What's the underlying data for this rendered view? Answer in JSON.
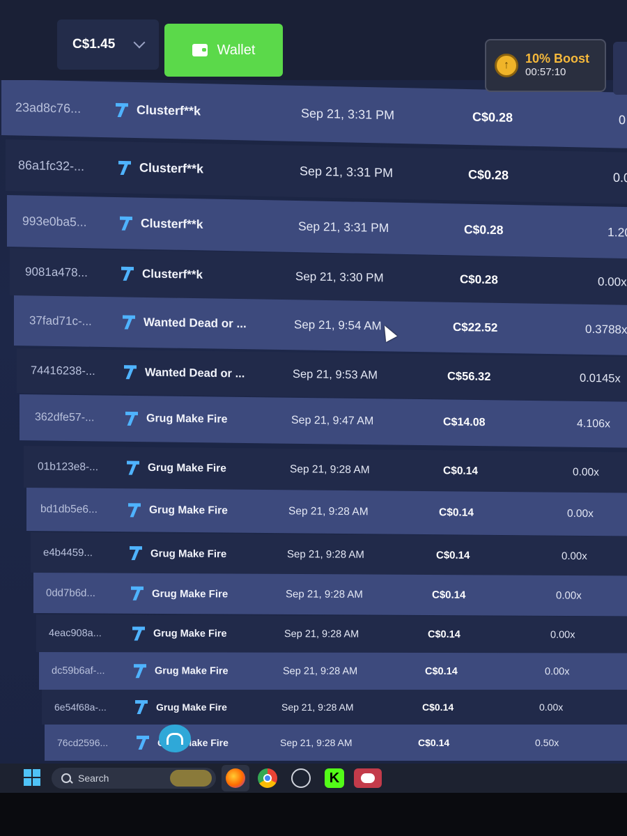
{
  "header": {
    "balance": "C$1.45",
    "wallet_label": "Wallet",
    "boost_label": "10% Boost",
    "boost_timer": "00:57:10"
  },
  "bets": [
    {
      "id": "23ad8c76...",
      "game": "Clusterf**k",
      "date": "Sep 21, 3:31 PM",
      "amount": "C$0.28",
      "multiplier": "0"
    },
    {
      "id": "86a1fc32-...",
      "game": "Clusterf**k",
      "date": "Sep 21, 3:31 PM",
      "amount": "C$0.28",
      "multiplier": "0.0"
    },
    {
      "id": "993e0ba5...",
      "game": "Clusterf**k",
      "date": "Sep 21, 3:31 PM",
      "amount": "C$0.28",
      "multiplier": "1.20"
    },
    {
      "id": "9081a478...",
      "game": "Clusterf**k",
      "date": "Sep 21, 3:30 PM",
      "amount": "C$0.28",
      "multiplier": "0.00x"
    },
    {
      "id": "37fad71c-...",
      "game": "Wanted Dead or ...",
      "date": "Sep 21, 9:54 AM",
      "amount": "C$22.52",
      "multiplier": "0.3788x"
    },
    {
      "id": "74416238-...",
      "game": "Wanted Dead or ...",
      "date": "Sep 21, 9:53 AM",
      "amount": "C$56.32",
      "multiplier": "0.0145x"
    },
    {
      "id": "362dfe57-...",
      "game": "Grug Make Fire",
      "date": "Sep 21, 9:47 AM",
      "amount": "C$14.08",
      "multiplier": "4.106x"
    },
    {
      "id": "01b123e8-...",
      "game": "Grug Make Fire",
      "date": "Sep 21, 9:28 AM",
      "amount": "C$0.14",
      "multiplier": "0.00x"
    },
    {
      "id": "bd1db5e6...",
      "game": "Grug Make Fire",
      "date": "Sep 21, 9:28 AM",
      "amount": "C$0.14",
      "multiplier": "0.00x"
    },
    {
      "id": "e4b4459...",
      "game": "Grug Make Fire",
      "date": "Sep 21, 9:28 AM",
      "amount": "C$0.14",
      "multiplier": "0.00x"
    },
    {
      "id": "0dd7b6d...",
      "game": "Grug Make Fire",
      "date": "Sep 21, 9:28 AM",
      "amount": "C$0.14",
      "multiplier": "0.00x"
    },
    {
      "id": "4eac908a...",
      "game": "Grug Make Fire",
      "date": "Sep 21, 9:28 AM",
      "amount": "C$0.14",
      "multiplier": "0.00x"
    },
    {
      "id": "dc59b6af-...",
      "game": "Grug Make Fire",
      "date": "Sep 21, 9:28 AM",
      "amount": "C$0.14",
      "multiplier": "0.00x"
    },
    {
      "id": "6e54f68a-...",
      "game": "Grug Make Fire",
      "date": "Sep 21, 9:28 AM",
      "amount": "C$0.14",
      "multiplier": "0.00x"
    },
    {
      "id": "76cd2596...",
      "game": "Grug Make Fire",
      "date": "Sep 21, 9:28 AM",
      "amount": "C$0.14",
      "multiplier": "0.50x"
    }
  ],
  "taskbar": {
    "search_label": "Search",
    "apps": [
      "firefox-icon",
      "chrome-icon",
      "steam-icon",
      "kick-icon",
      "discord-icon"
    ]
  },
  "colors": {
    "wallet_button": "#5bd94a",
    "boost_text": "#f6b93b",
    "row_light": "#3d4a7d",
    "row_dark": "#212a4a",
    "game_icon": "#4fb3ff"
  }
}
